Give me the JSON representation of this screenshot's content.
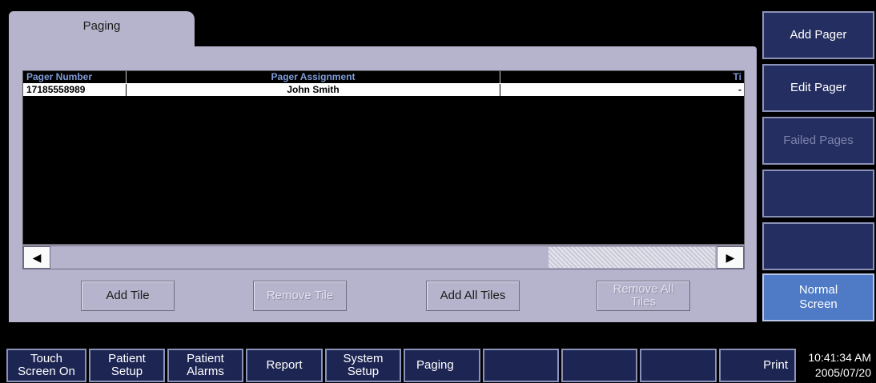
{
  "tab": {
    "label": "Paging"
  },
  "table": {
    "columns": [
      "Pager Number",
      "Pager Assignment",
      "Ti"
    ],
    "rows": [
      {
        "number": "17185558989",
        "assignment": "John Smith",
        "time": "-"
      }
    ]
  },
  "scrollbar": {
    "left_arrow": "◀",
    "right_arrow": "▶"
  },
  "panel_buttons": {
    "add_tile": "Add Tile",
    "remove_tile": "Remove Tile",
    "add_all_tiles": "Add All Tiles",
    "remove_all_tiles_line1": "Remove All",
    "remove_all_tiles_line2": "Tiles"
  },
  "right_buttons": {
    "add_pager": "Add Pager",
    "edit_pager": "Edit Pager",
    "failed_pages": "Failed Pages",
    "blank1": "",
    "blank2": "",
    "normal_screen_line1": "Normal",
    "normal_screen_line2": "Screen"
  },
  "bottom_bar": {
    "touch_screen_line1": "Touch",
    "touch_screen_line2": "Screen On",
    "patient_setup_line1": "Patient",
    "patient_setup_line2": "Setup",
    "patient_alarms_line1": "Patient",
    "patient_alarms_line2": "Alarms",
    "report": "Report",
    "system_setup_line1": "System",
    "system_setup_line2": "Setup",
    "paging": "Paging",
    "print": "Print"
  },
  "clock": {
    "time": "10:41:34 AM",
    "date": "2005/07/20"
  },
  "colors": {
    "panel": "#b6b4cc",
    "button_dark": "#242e60",
    "button_active": "#4e7ac6",
    "header_text": "#7f9bd8"
  }
}
